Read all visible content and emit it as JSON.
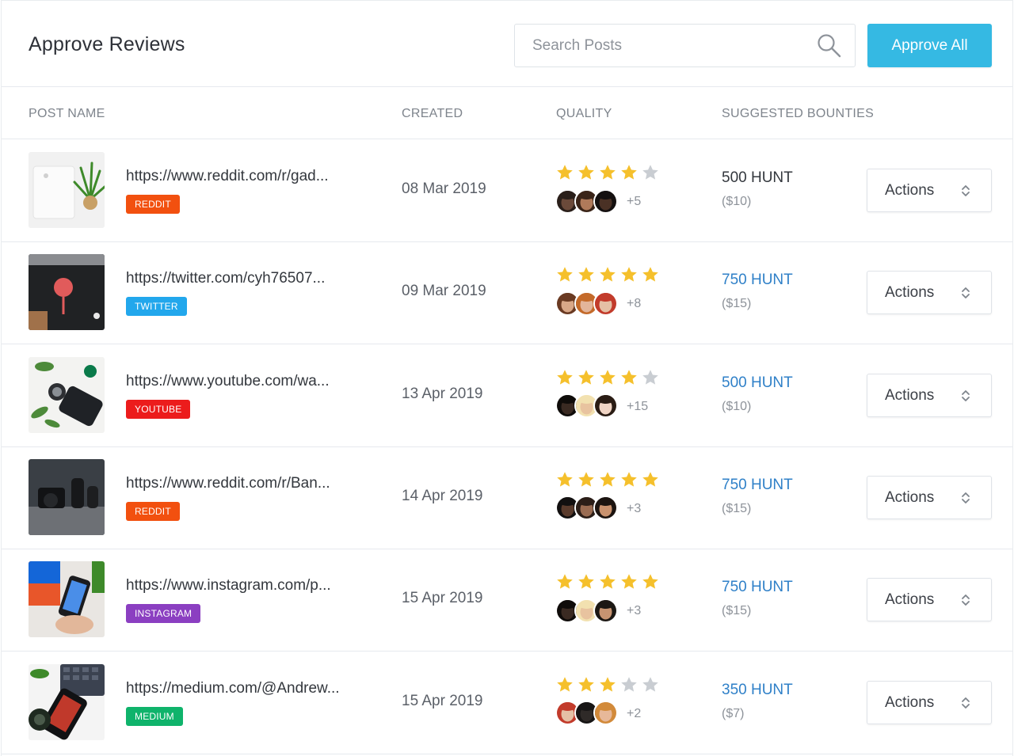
{
  "header": {
    "title": "Approve Reviews",
    "search_placeholder": "Search Posts",
    "approve_all_label": "Approve All"
  },
  "columns": [
    "POST NAME",
    "CREATED",
    "QUALITY",
    "SUGGESTED BOUNTIES"
  ],
  "colors": {
    "accent": "#35b9e3",
    "link_blue": "#2f80c8",
    "star_gold": "#f5c02c",
    "star_gray": "#c9cdd2"
  },
  "rows": [
    {
      "post": "https://www.reddit.com/r/gad...",
      "platform": "REDDIT",
      "platform_color": "#f2500f",
      "created": "08 Mar 2019",
      "stars": 4,
      "more": "+5",
      "bounty": "500 HUNT",
      "bounty_usd": "($10)",
      "bounty_highlight": false,
      "actions_label": "Actions"
    },
    {
      "post": "https://twitter.com/cyh76507...",
      "platform": "TWITTER",
      "platform_color": "#22a7ec",
      "created": "09 Mar 2019",
      "stars": 5,
      "more": "+8",
      "bounty": "750 HUNT",
      "bounty_usd": "($15)",
      "bounty_highlight": true,
      "actions_label": "Actions"
    },
    {
      "post": "https://www.youtube.com/wa...",
      "platform": "YOUTUBE",
      "platform_color": "#ec1c1c",
      "created": "13 Apr 2019",
      "stars": 4,
      "more": "+15",
      "bounty": "500 HUNT",
      "bounty_usd": "($10)",
      "bounty_highlight": true,
      "actions_label": "Actions"
    },
    {
      "post": "https://www.reddit.com/r/Ban...",
      "platform": "REDDIT",
      "platform_color": "#f2500f",
      "created": "14 Apr 2019",
      "stars": 5,
      "more": "+3",
      "bounty": "750 HUNT",
      "bounty_usd": "($15)",
      "bounty_highlight": true,
      "actions_label": "Actions"
    },
    {
      "post": "https://www.instagram.com/p...",
      "platform": "INSTAGRAM",
      "platform_color": "#8b3fc1",
      "created": "15 Apr 2019",
      "stars": 5,
      "more": "+3",
      "bounty": "750 HUNT",
      "bounty_usd": "($15)",
      "bounty_highlight": true,
      "actions_label": "Actions"
    },
    {
      "post": "https://medium.com/@Andrew...",
      "platform": "MEDIUM",
      "platform_color": "#0fb36b",
      "created": "15 Apr 2019",
      "stars": 3,
      "more": "+2",
      "bounty": "350 HUNT",
      "bounty_usd": "($7)",
      "bounty_highlight": true,
      "actions_label": "Actions"
    }
  ]
}
